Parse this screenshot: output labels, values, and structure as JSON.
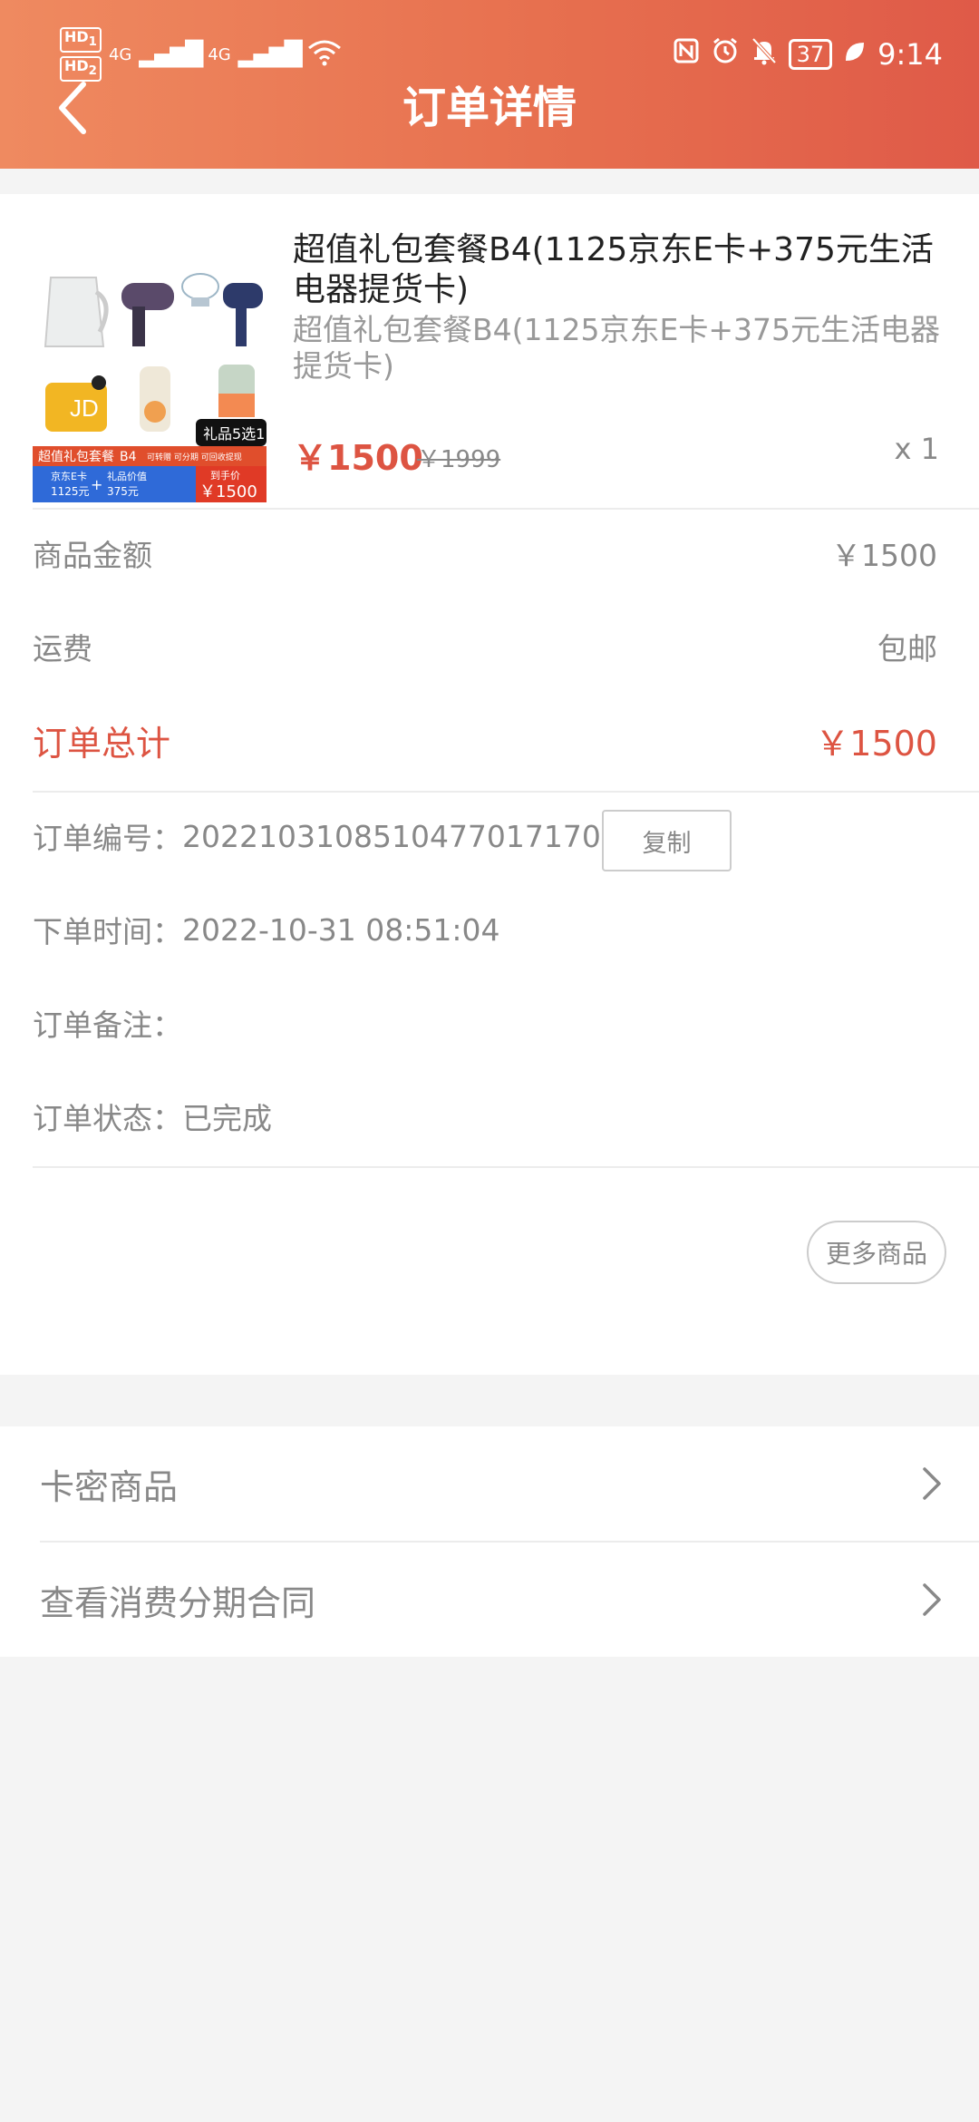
{
  "status_bar": {
    "hd1": "HD",
    "hd1_sub": "1",
    "hd2": "HD",
    "hd2_sub": "2",
    "net1": "4G",
    "net2": "4G",
    "wifi_label": "6",
    "battery": "37",
    "time": "9:14",
    "icons": [
      "nfc-icon",
      "alarm-icon",
      "bell-off-icon",
      "leaf-icon"
    ]
  },
  "header": {
    "title": "订单详情",
    "back_icon": "chevron-left-icon",
    "colors": {
      "start": "#ef8a60",
      "end": "#df5a48"
    }
  },
  "product": {
    "name": "超值礼包套餐B4(1125京东E卡+375元生活电器提货卡)",
    "subtitle": "超值礼包套餐B4(1125京东E卡+375元生活电器提货卡)",
    "price": "￥1500",
    "original_price": "￥1999",
    "quantity": "x 1",
    "thumbnail": {
      "tag": "礼品5选1",
      "banner": "超值礼包套餐",
      "banner_code": "B4",
      "banner_tags": "可转赠 可分期 可回收提现",
      "card_label": "京东E卡",
      "card_value": "1125元",
      "plus": "+",
      "gift_label": "礼品价值",
      "gift_value": "375元",
      "final_label": "到手价",
      "final_value": "￥1500",
      "jd_logo": "JD"
    }
  },
  "summary": {
    "goods_label": "商品金额",
    "goods_value": "￥1500",
    "shipping_label": "运费",
    "shipping_value": "包邮",
    "total_label": "订单总计",
    "total_value": "￥1500"
  },
  "order": {
    "number_label": "订单编号：",
    "number": "20221031085104770171​70",
    "copy": "复制",
    "time_label": "下单时间：",
    "time": "2022-10-31 08:51:04",
    "note_label": "订单备注：",
    "note": "",
    "status_label": "订单状态：",
    "status": "已完成"
  },
  "more_goods": "更多商品",
  "links": [
    {
      "label": "卡密商品",
      "icon": "chevron-right-icon"
    },
    {
      "label": "查看消费分期合同",
      "icon": "chevron-right-icon"
    }
  ],
  "accent_color": "#dd5442"
}
